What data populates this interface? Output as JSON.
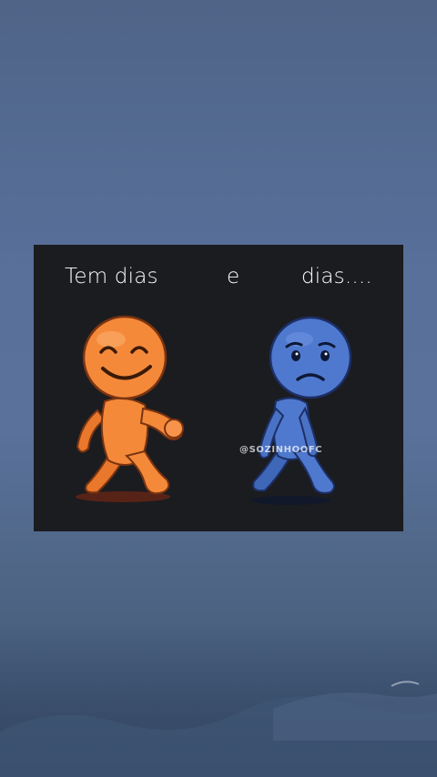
{
  "meme": {
    "caption_left": "Tem dias",
    "caption_middle": "e",
    "caption_right": "dias....",
    "watermark": "@SOZINHOOFC"
  },
  "colors": {
    "background": "#55698f",
    "card": "#1b1c20",
    "happy_figure": "#f5893a",
    "sad_figure": "#4f79cf"
  }
}
